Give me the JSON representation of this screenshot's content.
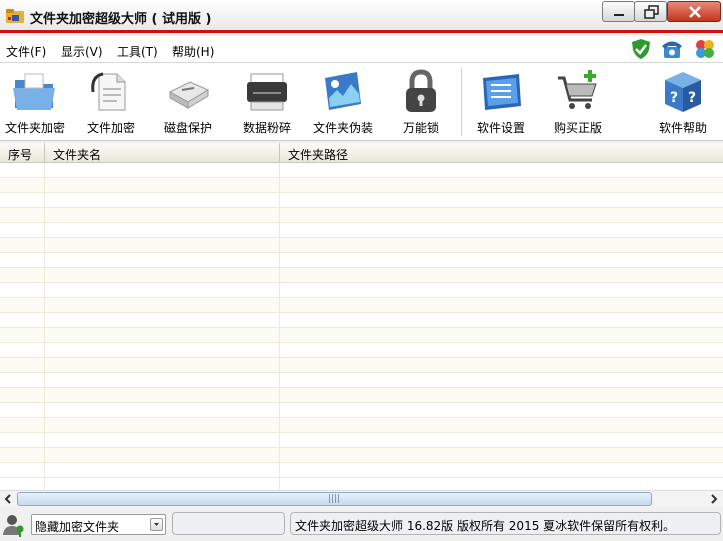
{
  "window": {
    "title": "文件夹加密超级大师 ( 试用版 )",
    "icons": {
      "app": "folder-lock-app-icon",
      "minimize": "minimize-icon",
      "maximize": "restore-icon",
      "close": "close-icon"
    }
  },
  "menu": {
    "items": [
      {
        "label": "文件(F)"
      },
      {
        "label": "显示(V)"
      },
      {
        "label": "工具(T)"
      },
      {
        "label": "帮助(H)"
      }
    ],
    "right_icons": [
      "shield-check-icon",
      "telephone-icon",
      "puzzle-icon"
    ]
  },
  "toolbar": {
    "items": [
      {
        "label": "文件夹加密",
        "icon": "folder-encrypt-icon"
      },
      {
        "label": "文件加密",
        "icon": "file-encrypt-icon"
      },
      {
        "label": "磁盘保护",
        "icon": "usb-drive-icon"
      },
      {
        "label": "数据粉碎",
        "icon": "shredder-icon"
      },
      {
        "label": "文件夹伪装",
        "icon": "folder-disguise-icon"
      },
      {
        "label": "万能锁",
        "icon": "padlock-icon"
      },
      {
        "label": "软件设置",
        "icon": "settings-panel-icon"
      },
      {
        "label": "购买正版",
        "icon": "shopping-cart-icon"
      },
      {
        "label": "软件帮助",
        "icon": "help-cube-icon"
      }
    ]
  },
  "table": {
    "columns": [
      "序号",
      "文件夹名",
      "文件夹路径"
    ],
    "rows": []
  },
  "statusbar": {
    "mode_icon": "user-key-icon",
    "select_value": "隐藏加密文件夹",
    "middle_panel": "",
    "copyright": "文件夹加密超级大师 16.82版 版权所有 2015 夏冰软件保留所有权利。"
  },
  "colors": {
    "accent_red": "#d01010",
    "selection_blue": "#c5d9ef"
  }
}
